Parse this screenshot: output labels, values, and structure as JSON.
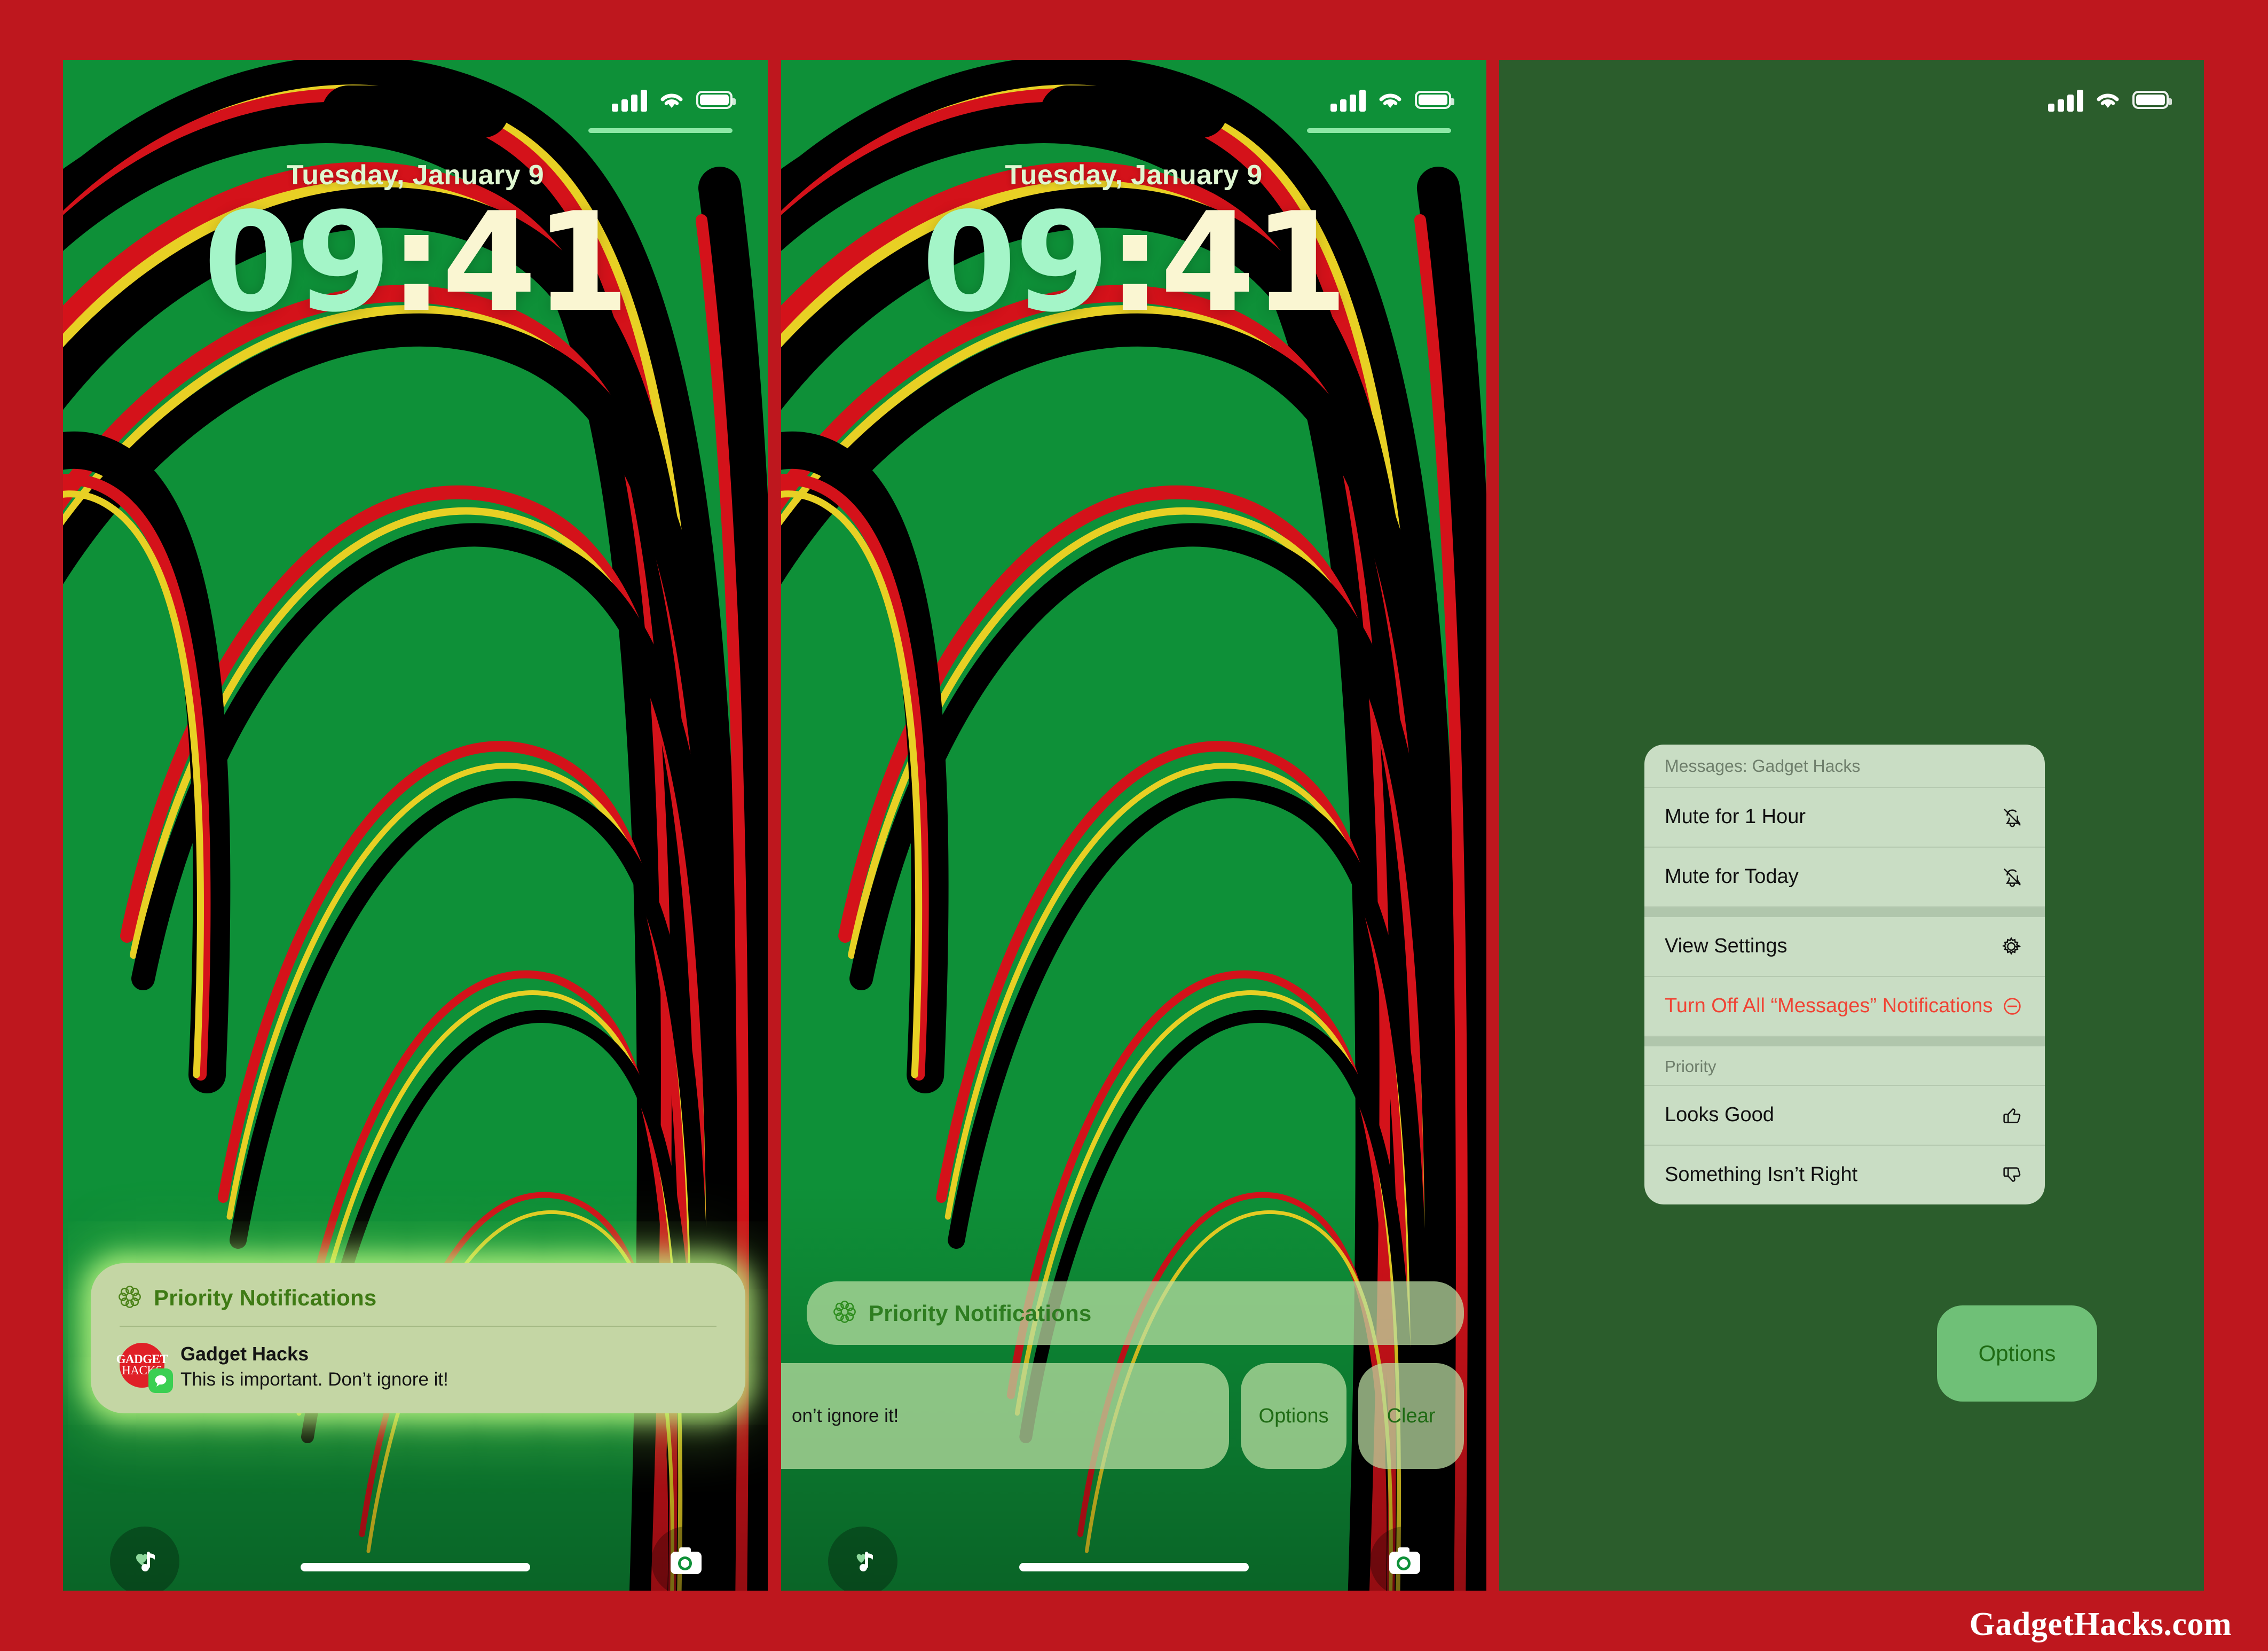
{
  "page": {
    "background_color": "#BE171E",
    "watermark": "GadgetHacks.com"
  },
  "status_bar": {
    "signal_icon": "cellular-signal-icon",
    "wifi_icon": "wifi-icon",
    "battery_icon": "battery-icon"
  },
  "lockscreen": {
    "date": "Tuesday, January 9",
    "time_hours": "09",
    "time_separator": ":",
    "time_minutes": "41",
    "clock_hours_color": "#A4F5C8",
    "clock_minutes_color": "#FAF6D2",
    "left_control_icon": "music-recognition-icon",
    "right_control_icon": "camera-icon"
  },
  "panel1": {
    "notification_card": {
      "header_icon": "apple-intelligence-flower-icon",
      "header_label": "Priority Notifications",
      "header_color": "#3E7A14",
      "app_name": "Gadget Hacks",
      "message": "This is important. Don’t ignore it!",
      "avatar_line1": "GADGET",
      "avatar_line2": "HACKS",
      "avatar_color": "#E02027",
      "badge_icon": "messages-app-icon",
      "badge_color": "#3ACF52",
      "glow_color": "#C8FF8C"
    }
  },
  "panel2": {
    "priority_banner": {
      "header_icon": "apple-intelligence-flower-icon",
      "header_label": "Priority Notifications"
    },
    "swiped_notification": {
      "truncated_text": "on’t ignore it!",
      "options_label": "Options",
      "clear_label": "Clear"
    }
  },
  "panel3": {
    "background_color": "#2B5D2C",
    "context_menu": {
      "header": "Messages: Gadget Hacks",
      "groups": [
        {
          "items": [
            {
              "label": "Mute for 1 Hour",
              "icon": "bell-slash-icon",
              "destructive": false
            },
            {
              "label": "Mute for Today",
              "icon": "bell-slash-icon",
              "destructive": false
            }
          ]
        },
        {
          "items": [
            {
              "label": "View Settings",
              "icon": "gear-icon",
              "destructive": false
            },
            {
              "label": "Turn Off All “Messages” Notifications",
              "icon": "minus-circle-icon",
              "destructive": true
            }
          ]
        },
        {
          "subheader": "Priority",
          "items": [
            {
              "label": "Looks Good",
              "icon": "thumbs-up-icon",
              "destructive": false
            },
            {
              "label": "Something Isn’t Right",
              "icon": "thumbs-down-icon",
              "destructive": false
            }
          ]
        }
      ]
    },
    "options_button": {
      "label": "Options",
      "background_color": "#6FC077",
      "text_color": "#1F6B14"
    }
  }
}
